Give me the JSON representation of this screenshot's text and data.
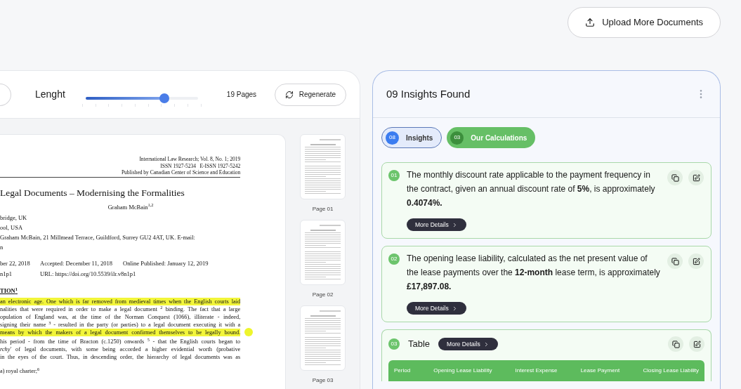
{
  "upload_button": {
    "label": "Upload More Documents"
  },
  "toolbar": {
    "length_label": "Lenght",
    "slider": {
      "level": 0.7
    },
    "pages": "19 Pages",
    "regenerate": "Regenerate"
  },
  "document": {
    "journal_lines": [
      "International Law Research; Vol. 8, No. 1; 2019",
      "ISSN 1927-5234   E-ISSN 1927-5242",
      "Published by Canadian Center of Science and Education"
    ],
    "title": "Legal Documents – Modernising the Formalities",
    "author": "Graham McBain$^{1,2}$",
    "affiliations": [
      "bridge, UK",
      "ool, USA",
      "Graham McBain, 21 Millmead Terrace, Guildford, Surrey GU2 4AT, UK. E-mail:",
      "n"
    ],
    "dates": [
      [
        "ber 22, 2018",
        "Accepted: December 11, 2018",
        "Online Published: January 12, 2019"
      ],
      [
        "n1p1",
        "URL: https://doi.org/10.5539/ilr.v8n1p1"
      ]
    ],
    "heading": "TION$^{1}$",
    "paragraph": [
      {
        "text": "an electronic age. One which is far removed from medieval times when the English courts laid",
        "highlighted": true
      },
      {
        "text": "nalities that were required in order to make a legal document $^{2}$ binding. The fact that a large",
        "highlighted": false
      },
      {
        "text": "opulation of England was, at the time of the Norman Conquest (1066), illiterate - indeed,",
        "highlighted": false
      },
      {
        "text": "signing their name $^{3}$ - resulted in the party (or parties) to a legal document executing it with a",
        "highlighted": false
      },
      {
        "text": "means by which the makers of a legal document confirmed themselves to be legally bound.",
        "highlighted": true
      }
    ],
    "paragraph2": [
      "his period - from the time of Bracton (c.1250) onwards $^{5}$ - that the English courts began to",
      "*rchy*' of legal documents, with some being accorded a higher evidential worth (probative",
      "in the eyes of the court. Thus, in descending order, the hierarchy of legal documents was as"
    ],
    "list_item": "a) royal charter;$^{6}$"
  },
  "thumbnails": [
    {
      "label": "Page 01",
      "selected": false
    },
    {
      "label": "Page 02",
      "selected": false
    },
    {
      "label": "Page 03",
      "selected": false
    }
  ],
  "insights_panel": {
    "title": "09 Insights Found",
    "tabs": [
      {
        "count": "08",
        "label": "Insights",
        "selected": false
      },
      {
        "count": "03",
        "label": "Our Calculations",
        "selected": true
      }
    ],
    "items": [
      {
        "kind": "text",
        "number": "01",
        "text": "The monthly discount rate applicable to the payment frequency in the contract, given an annual discount rate of **5%**, is approximately **0.4074%.**",
        "button": "More Details"
      },
      {
        "kind": "text",
        "number": "02",
        "text": "The opening lease liability, calculated as the net present value of the lease payments over the **12-month** lease term, is approximately **£17,897.08.**",
        "button": "More Details"
      },
      {
        "kind": "table",
        "number": "03",
        "title": "Table",
        "button": "More Details",
        "columns": [
          "Period",
          "Opening Lease Liability",
          "Interest Expense",
          "Lease Payment",
          "Closing Lease Liability"
        ]
      }
    ]
  }
}
